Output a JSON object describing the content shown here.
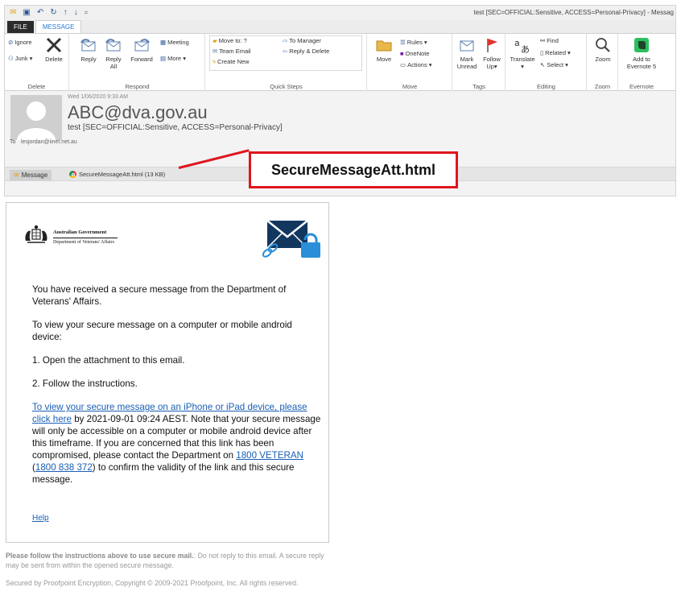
{
  "window": {
    "title": "test [SEC=OFFICIAL:Sensitive, ACCESS=Personal-Privacy] - Messag",
    "qat_more": "="
  },
  "tabs": {
    "file": "FILE",
    "message": "MESSAGE"
  },
  "ribbon": {
    "delete_group": {
      "title": "Delete",
      "ignore": "Ignore",
      "junk": "Junk",
      "junk_caret": "▾",
      "delete": "Delete"
    },
    "respond_group": {
      "title": "Respond",
      "reply": "Reply",
      "reply_all_1": "Reply",
      "reply_all_2": "All",
      "forward": "Forward",
      "meeting": "Meeting",
      "more": "More"
    },
    "quick_steps": {
      "title": "Quick Steps",
      "move_to": "Move to: ?",
      "team_email": "Team Email",
      "create_new": "Create New",
      "to_manager": "To Manager",
      "reply_delete": "Reply & Delete"
    },
    "move_group": {
      "title": "Move",
      "move": "Move",
      "rules": "Rules",
      "onenote": "OneNote",
      "actions": "Actions"
    },
    "tags_group": {
      "title": "Tags",
      "mark_unread_1": "Mark",
      "mark_unread_2": "Unread",
      "follow_up_1": "Follow",
      "follow_up_2": "Up"
    },
    "editing_group": {
      "title": "Editing",
      "translate": "Translate",
      "find": "Find",
      "related": "Related",
      "select": "Select"
    },
    "zoom_group": {
      "title": "Zoom",
      "zoom": "Zoom"
    },
    "evernote_group": {
      "title": "Evernote",
      "add_1": "Add to",
      "add_2": "Evernote 5"
    }
  },
  "message": {
    "date": "Wed 1/06/2020 9:33 AM",
    "from": "ABC@dva.gov.au",
    "subject": "test [SEC=OFFICIAL:Sensitive, ACCESS=Personal-Privacy]",
    "to_label": "To",
    "to": "lesjordan@iinet.net.au",
    "attachments": {
      "message_tab": "Message",
      "file": "SecureMessageAtt.html (13 KB)"
    }
  },
  "annotation": {
    "label": "SecureMessageAtt.html",
    "color": "#e0141e"
  },
  "secure_message": {
    "logo": {
      "line1": "Australian Government",
      "line2": "Department of Veterans' Affairs"
    },
    "p1": "You have received a secure message from the Department of Veterans' Affairs.",
    "p2": "To view your secure message on a computer or mobile android device:",
    "step1": "1. Open the attachment to this email.",
    "step2": "2. Follow the instructions.",
    "link_iphone": "To view your secure message on an iPhone or iPad device, please click here",
    "p3_mid": " by 2021-09-01 09:24 AEST. Note that your secure message will only be accessible on a computer or mobile android device after this timeframe. If you are concerned that this link has been compromised, please contact the Department on ",
    "phone_name": "1800 VETERAN",
    "open_paren": " (",
    "phone_number": "1800 838 372",
    "p3_end": ") to confirm the validity of the link and this secure message.",
    "help": "Help"
  },
  "footer": {
    "bold": "Please follow the instructions above to use secure mail.",
    "rest": ": Do not reply to this email. A secure reply may be sent from within the opened secure message.",
    "copyright": "Secured by Proofpoint Encryption, Copyright © 2009-2021 Proofpoint, Inc. All rights reserved."
  },
  "colors": {
    "link": "#1a5fb4",
    "accent": "#2b7bd3"
  }
}
